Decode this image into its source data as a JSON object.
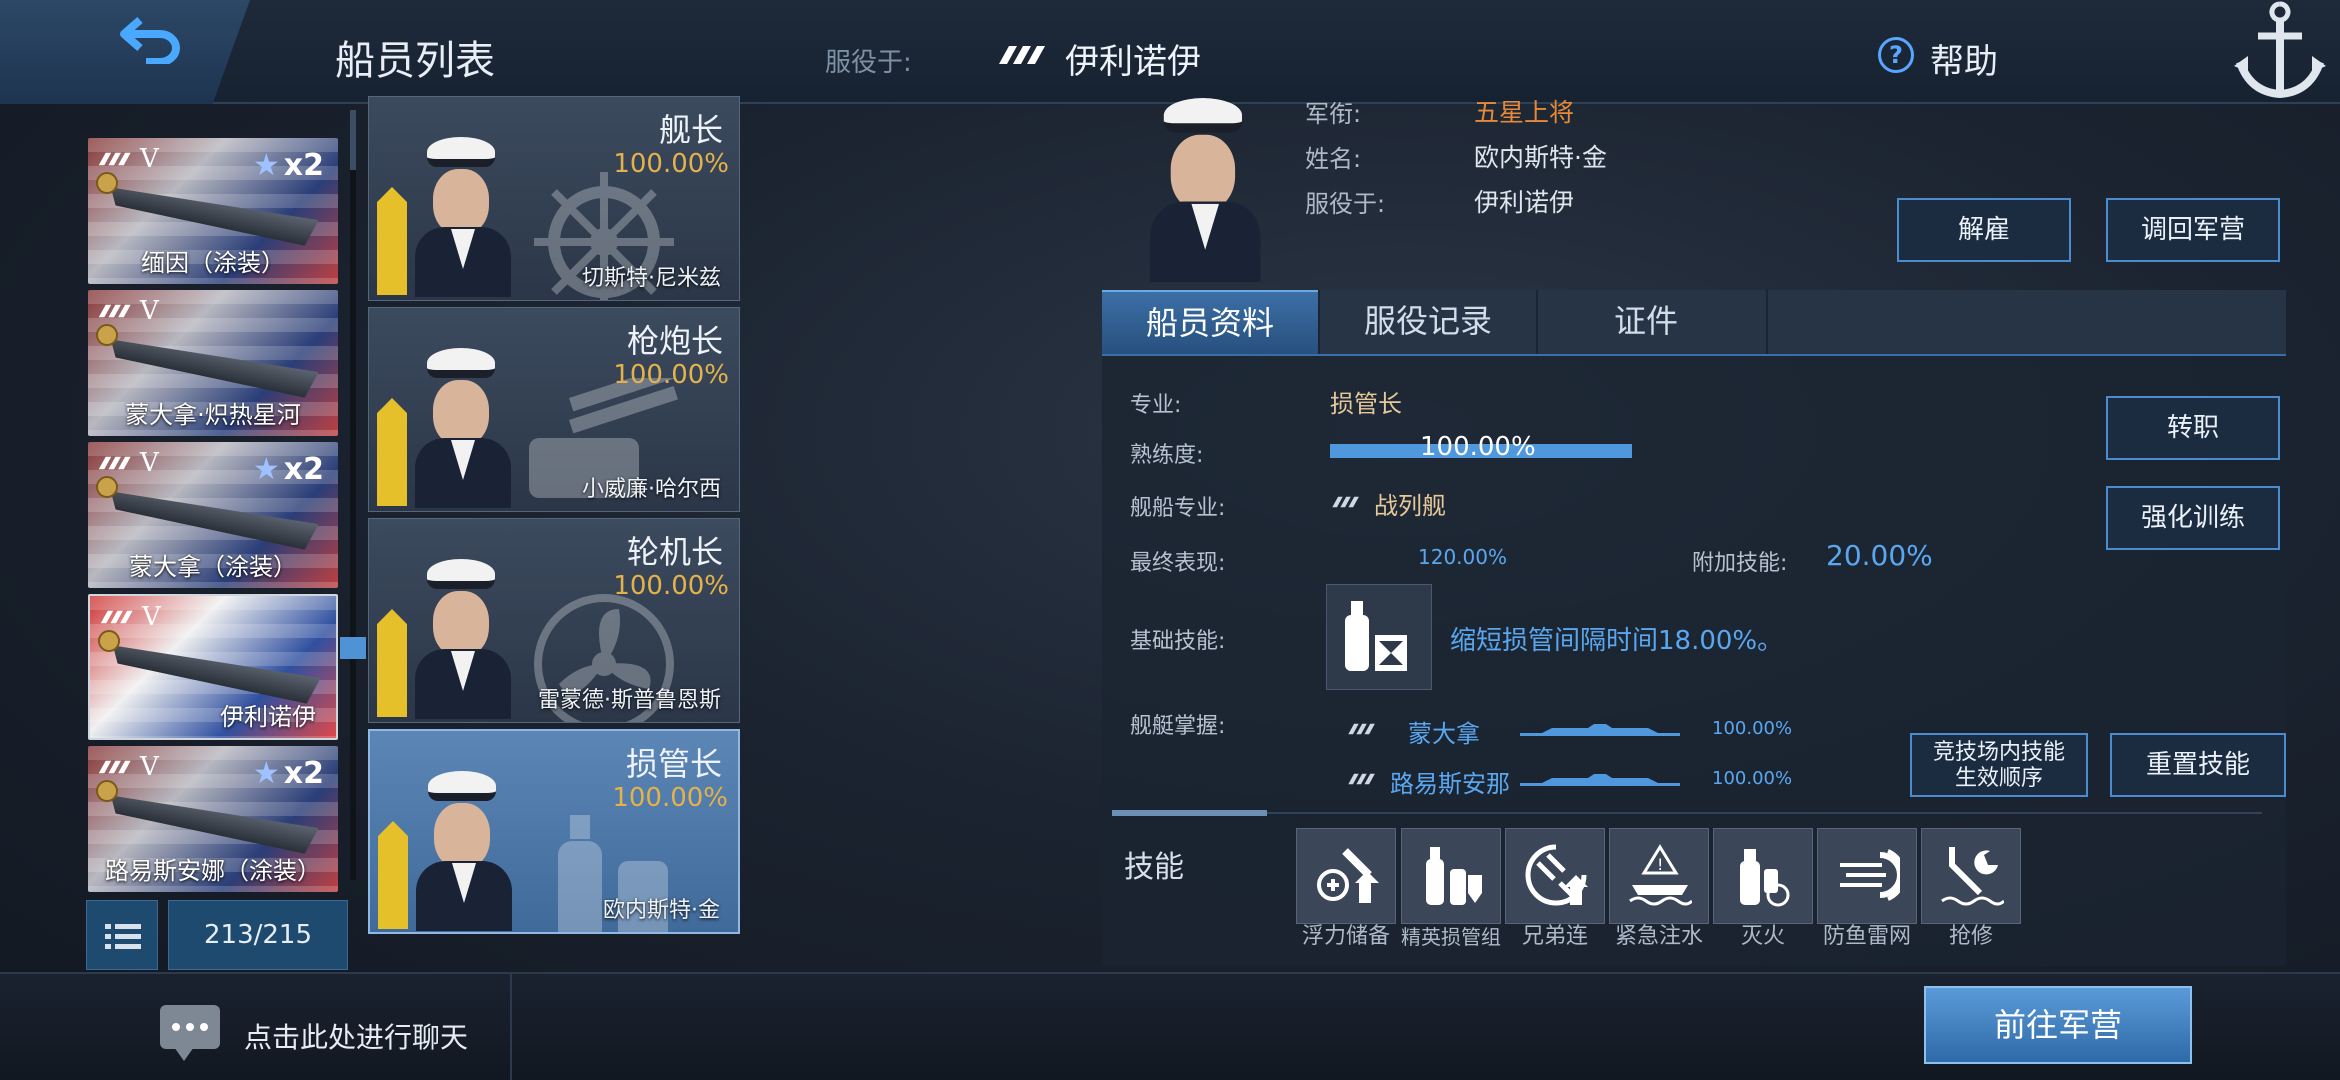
{
  "header": {
    "title": "船员列表",
    "serving_label": "服役于:",
    "serving_ship": "伊利诺伊",
    "help_label": "帮助"
  },
  "ship_list": {
    "items": [
      {
        "name": "缅因（涂装）",
        "tier": "V",
        "multiplier": "x2"
      },
      {
        "name": "蒙大拿·炽热星河",
        "tier": "V",
        "multiplier": ""
      },
      {
        "name": "蒙大拿（涂装）",
        "tier": "V",
        "multiplier": "x2"
      },
      {
        "name": "伊利诺伊",
        "tier": "V",
        "multiplier": ""
      },
      {
        "name": "路易斯安娜（涂装）",
        "tier": "V",
        "multiplier": "x2"
      }
    ],
    "count": "213/215"
  },
  "crew_cards": [
    {
      "role": "舰长",
      "proficiency": "100.00%",
      "name": "切斯特·尼米兹"
    },
    {
      "role": "枪炮长",
      "proficiency": "100.00%",
      "name": "小威廉·哈尔西"
    },
    {
      "role": "轮机长",
      "proficiency": "100.00%",
      "name": "雷蒙德·斯普鲁恩斯"
    },
    {
      "role": "损管长",
      "proficiency": "100.00%",
      "name": "欧内斯特·金"
    }
  ],
  "detail": {
    "rank_label": "军衔:",
    "rank_value": "五星上将",
    "name_label": "姓名:",
    "name_value": "欧内斯特·金",
    "serving_label": "服役于:",
    "serving_value": "伊利诺伊",
    "dismiss_button": "解雇",
    "recall_button": "调回军营"
  },
  "tabs": [
    "船员资料",
    "服役记录",
    "证件"
  ],
  "profile": {
    "specialty_label": "专业:",
    "specialty_value": "损管长",
    "proficiency_label": "熟练度:",
    "proficiency_value": "100.00%",
    "proficiency_fraction": 1.0,
    "ship_specialty_label": "舰船专业:",
    "ship_specialty_value": "战列舰",
    "final_perf_label": "最终表现:",
    "final_perf_value": "120.00%",
    "extra_skill_label": "附加技能:",
    "extra_skill_value": "20.00%",
    "base_skill_label": "基础技能:",
    "base_skill_desc": "缩短损管间隔时间18.00%。",
    "mastery_label": "舰艇掌握:",
    "mastery": [
      {
        "ship": "蒙大拿",
        "value": "100.00%"
      },
      {
        "ship": "路易斯安那",
        "value": "100.00%"
      }
    ],
    "transfer_button": "转职",
    "training_button": "强化训练",
    "arena_order_button_line1": "竞技场内技能",
    "arena_order_button_line2": "生效顺序",
    "reset_skills_button": "重置技能"
  },
  "skills": {
    "label": "技能",
    "items": [
      {
        "name": "浮力储备",
        "icon": "buoyancy-icon"
      },
      {
        "name": "精英损管组",
        "icon": "elite-damage-control-icon"
      },
      {
        "name": "兄弟连",
        "icon": "brotherhood-icon"
      },
      {
        "name": "紧急注水",
        "icon": "emergency-flooding-icon"
      },
      {
        "name": "灭火",
        "icon": "extinguisher-icon"
      },
      {
        "name": "防鱼雷网",
        "icon": "torpedo-net-icon"
      },
      {
        "name": "抢修",
        "icon": "repair-icon"
      }
    ]
  },
  "footer": {
    "chat_prompt": "点击此处进行聊天",
    "goto_barracks": "前往军营"
  }
}
